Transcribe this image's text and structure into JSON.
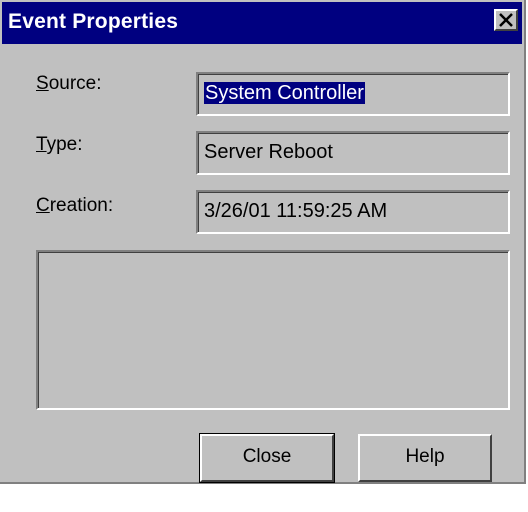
{
  "window": {
    "title": "Event Properties",
    "close_glyph": "✕"
  },
  "fields": {
    "source": {
      "label": "Source:",
      "hotkey": "S",
      "rest": "ource:",
      "value": "System Controller"
    },
    "type": {
      "label": "Type:",
      "hotkey": "T",
      "rest": "ype:",
      "value": "Server Reboot"
    },
    "creation": {
      "label": "Creation:",
      "hotkey": "C",
      "rest": "reation:",
      "value": "3/26/01 11:59:25 AM"
    }
  },
  "description": {
    "value": ""
  },
  "buttons": {
    "close_label": "Close",
    "help_label": "Help"
  },
  "colors": {
    "titlebar": "#000080",
    "face": "#c0c0c0",
    "selection": "#000080"
  }
}
